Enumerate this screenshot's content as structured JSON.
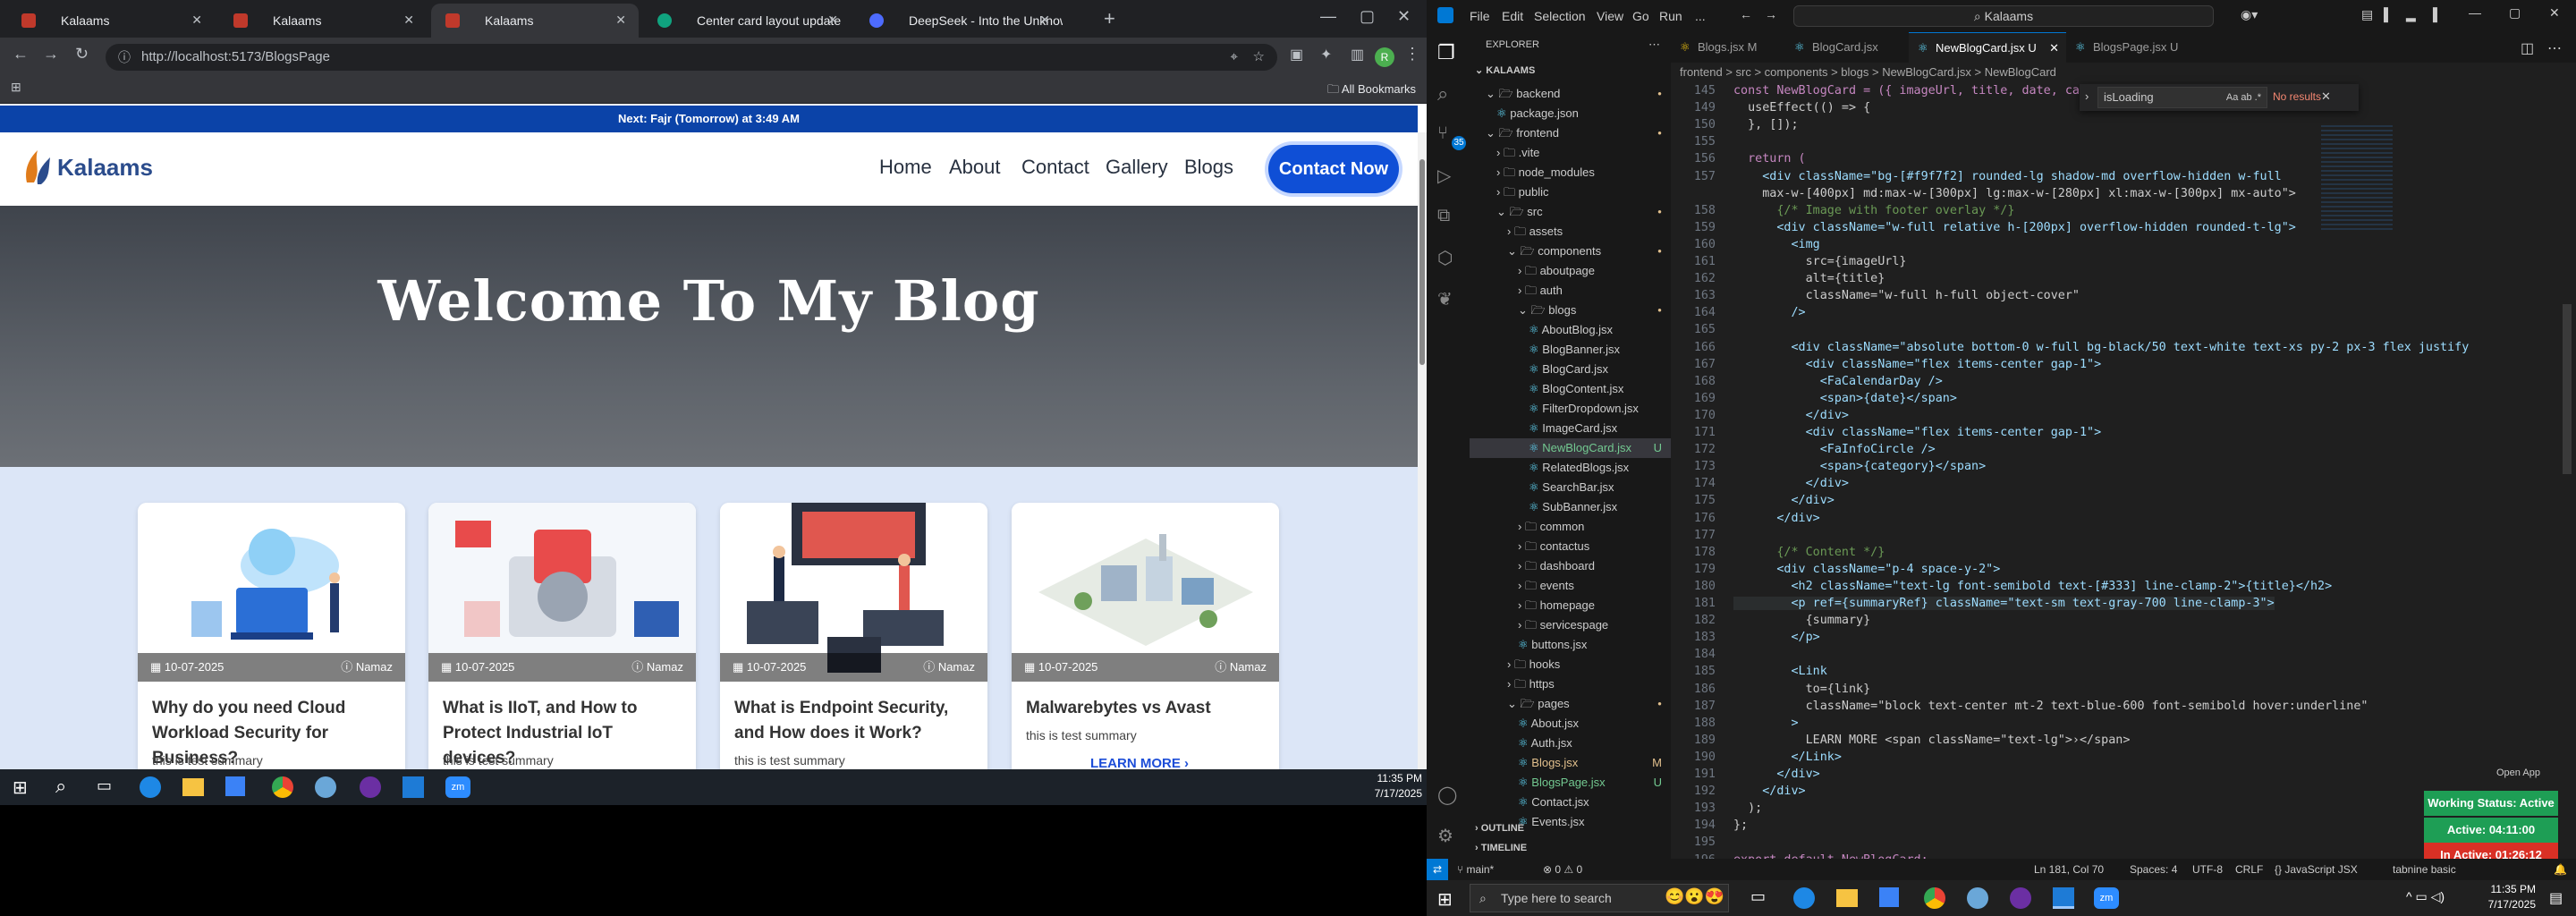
{
  "browser": {
    "tabs": [
      {
        "label": "Kalaams",
        "favcolor": "#c0392b"
      },
      {
        "label": "Kalaams",
        "favcolor": "#c0392b"
      },
      {
        "label": "Kalaams",
        "favcolor": "#c0392b"
      },
      {
        "label": "Center card layout update",
        "favcolor": "#10a37f"
      },
      {
        "label": "DeepSeek - Into the Unknown",
        "favcolor": "#4d6bfe"
      }
    ],
    "url": "http://localhost:5173/BlogsPage",
    "all_bookmarks": "All Bookmarks",
    "profile_initial": "R"
  },
  "site": {
    "announcement": "Next: Fajr (Tomorrow) at 3:49 AM",
    "logo": "Kalaams",
    "nav": [
      "Home",
      "About",
      "Contact",
      "Gallery",
      "Blogs"
    ],
    "cta": "Contact Now",
    "hero_title": "Welcome To My Blog",
    "cards": [
      {
        "date": "10-07-2025",
        "category": "Namaz",
        "title": "Why do you need Cloud Workload Security for Business?",
        "summary": "this is test summary",
        "more": ""
      },
      {
        "date": "10-07-2025",
        "category": "Namaz",
        "title": "What is IIoT, and How to Protect Industrial IoT devices?",
        "summary": "this is test summary",
        "more": ""
      },
      {
        "date": "10-07-2025",
        "category": "Namaz",
        "title": "What is Endpoint Security, and How does it Work?",
        "summary": "this is test summary",
        "more": ""
      },
      {
        "date": "10-07-2025",
        "category": "Namaz",
        "title": "Malwarebytes vs Avast",
        "summary": "this is test summary",
        "more": "LEARN MORE ›"
      }
    ]
  },
  "taskbar_left": {
    "time": "11:35 PM",
    "date": "7/17/2025"
  },
  "vscode": {
    "menu": [
      "File",
      "Edit",
      "Selection",
      "View",
      "Go",
      "Run",
      "..."
    ],
    "search": "Kalaams",
    "explorer_title": "EXPLORER",
    "root": "KALAAMS",
    "tree": [
      {
        "label": "backend",
        "indent": 1,
        "type": "folder-open",
        "status": "dot"
      },
      {
        "label": "package.json",
        "indent": 2,
        "type": "file",
        "status": ""
      },
      {
        "label": "frontend",
        "indent": 1,
        "type": "folder-open",
        "status": "dot"
      },
      {
        "label": ".vite",
        "indent": 2,
        "type": "folder",
        "status": ""
      },
      {
        "label": "node_modules",
        "indent": 2,
        "type": "folder",
        "status": ""
      },
      {
        "label": "public",
        "indent": 2,
        "type": "folder",
        "status": ""
      },
      {
        "label": "src",
        "indent": 2,
        "type": "folder-open",
        "status": "dot"
      },
      {
        "label": "assets",
        "indent": 3,
        "type": "folder",
        "status": ""
      },
      {
        "label": "components",
        "indent": 3,
        "type": "folder-open",
        "status": "dot"
      },
      {
        "label": "aboutpage",
        "indent": 4,
        "type": "folder",
        "status": ""
      },
      {
        "label": "auth",
        "indent": 4,
        "type": "folder",
        "status": ""
      },
      {
        "label": "blogs",
        "indent": 4,
        "type": "folder-open",
        "status": "dot"
      },
      {
        "label": "AboutBlog.jsx",
        "indent": 5,
        "type": "file",
        "status": ""
      },
      {
        "label": "BlogBanner.jsx",
        "indent": 5,
        "type": "file",
        "status": ""
      },
      {
        "label": "BlogCard.jsx",
        "indent": 5,
        "type": "file",
        "status": ""
      },
      {
        "label": "BlogContent.jsx",
        "indent": 5,
        "type": "file",
        "status": ""
      },
      {
        "label": "FilterDropdown.jsx",
        "indent": 5,
        "type": "file",
        "status": ""
      },
      {
        "label": "ImageCard.jsx",
        "indent": 5,
        "type": "file",
        "status": ""
      },
      {
        "label": "NewBlogCard.jsx",
        "indent": 5,
        "type": "file",
        "status": "U",
        "active": true
      },
      {
        "label": "RelatedBlogs.jsx",
        "indent": 5,
        "type": "file",
        "status": ""
      },
      {
        "label": "SearchBar.jsx",
        "indent": 5,
        "type": "file",
        "status": ""
      },
      {
        "label": "SubBanner.jsx",
        "indent": 5,
        "type": "file",
        "status": ""
      },
      {
        "label": "common",
        "indent": 4,
        "type": "folder",
        "status": ""
      },
      {
        "label": "contactus",
        "indent": 4,
        "type": "folder",
        "status": ""
      },
      {
        "label": "dashboard",
        "indent": 4,
        "type": "folder",
        "status": ""
      },
      {
        "label": "events",
        "indent": 4,
        "type": "folder",
        "status": ""
      },
      {
        "label": "homepage",
        "indent": 4,
        "type": "folder",
        "status": ""
      },
      {
        "label": "servicespage",
        "indent": 4,
        "type": "folder",
        "status": ""
      },
      {
        "label": "buttons.jsx",
        "indent": 4,
        "type": "file",
        "status": ""
      },
      {
        "label": "hooks",
        "indent": 3,
        "type": "folder",
        "status": ""
      },
      {
        "label": "https",
        "indent": 3,
        "type": "folder",
        "status": ""
      },
      {
        "label": "pages",
        "indent": 3,
        "type": "folder-open",
        "status": "dot"
      },
      {
        "label": "About.jsx",
        "indent": 4,
        "type": "file",
        "status": ""
      },
      {
        "label": "Auth.jsx",
        "indent": 4,
        "type": "file",
        "status": ""
      },
      {
        "label": "Blogs.jsx",
        "indent": 4,
        "type": "file",
        "status": "M"
      },
      {
        "label": "BlogsPage.jsx",
        "indent": 4,
        "type": "file",
        "status": "U"
      },
      {
        "label": "Contact.jsx",
        "indent": 4,
        "type": "file",
        "status": ""
      },
      {
        "label": "Events.jsx",
        "indent": 4,
        "type": "file",
        "status": ""
      }
    ],
    "outline": "OUTLINE",
    "timeline": "TIMELINE",
    "tabs": [
      {
        "label": "Blogs.jsx M",
        "active": false
      },
      {
        "label": "BlogCard.jsx",
        "active": false
      },
      {
        "label": "NewBlogCard.jsx U",
        "active": true
      },
      {
        "label": "BlogsPage.jsx U",
        "active": false
      }
    ],
    "breadcrumb": "frontend > src > components > blogs > NewBlogCard.jsx > NewBlogCard",
    "find": {
      "query": "isLoading",
      "result": "No results"
    },
    "code": [
      {
        "n": "145",
        "t": "const NewBlogCard = ({ imageUrl, title, date, cate"
      },
      {
        "n": "149",
        "t": "  useEffect(() => {"
      },
      {
        "n": "150",
        "t": "  }, []);"
      },
      {
        "n": "155",
        "t": ""
      },
      {
        "n": "156",
        "t": "  return ("
      },
      {
        "n": "157",
        "t": "    <div className=\"bg-[#f9f7f2] rounded-lg shadow-md overflow-hidden w-full"
      },
      {
        "n": "",
        "t": "    max-w-[400px] md:max-w-[300px] lg:max-w-[280px] xl:max-w-[300px] mx-auto\">"
      },
      {
        "n": "158",
        "t": "      {/* Image with footer overlay */}"
      },
      {
        "n": "159",
        "t": "      <div className=\"w-full relative h-[200px] overflow-hidden rounded-t-lg\">"
      },
      {
        "n": "160",
        "t": "        <img"
      },
      {
        "n": "161",
        "t": "          src={imageUrl}"
      },
      {
        "n": "162",
        "t": "          alt={title}"
      },
      {
        "n": "163",
        "t": "          className=\"w-full h-full object-cover\""
      },
      {
        "n": "164",
        "t": "        />"
      },
      {
        "n": "165",
        "t": ""
      },
      {
        "n": "166",
        "t": "        <div className=\"absolute bottom-0 w-full bg-black/50 text-white text-xs py-2 px-3 flex justify"
      },
      {
        "n": "167",
        "t": "          <div className=\"flex items-center gap-1\">"
      },
      {
        "n": "168",
        "t": "            <FaCalendarDay />"
      },
      {
        "n": "169",
        "t": "            <span>{date}</span>"
      },
      {
        "n": "170",
        "t": "          </div>"
      },
      {
        "n": "171",
        "t": "          <div className=\"flex items-center gap-1\">"
      },
      {
        "n": "172",
        "t": "            <FaInfoCircle />"
      },
      {
        "n": "173",
        "t": "            <span>{category}</span>"
      },
      {
        "n": "174",
        "t": "          </div>"
      },
      {
        "n": "175",
        "t": "        </div>"
      },
      {
        "n": "176",
        "t": "      </div>"
      },
      {
        "n": "177",
        "t": ""
      },
      {
        "n": "178",
        "t": "      {/* Content */}"
      },
      {
        "n": "179",
        "t": "      <div className=\"p-4 space-y-2\">"
      },
      {
        "n": "180",
        "t": "        <h2 className=\"text-lg font-semibold text-[#333] line-clamp-2\">{title}</h2>"
      },
      {
        "n": "181",
        "t": "        <p ref={summaryRef} className=\"text-sm text-gray-700 line-clamp-3\">"
      },
      {
        "n": "182",
        "t": "          {summary}"
      },
      {
        "n": "183",
        "t": "        </p>"
      },
      {
        "n": "184",
        "t": ""
      },
      {
        "n": "185",
        "t": "        <Link"
      },
      {
        "n": "186",
        "t": "          to={link}"
      },
      {
        "n": "187",
        "t": "          className=\"block text-center mt-2 text-blue-600 font-semibold hover:underline\""
      },
      {
        "n": "188",
        "t": "        >"
      },
      {
        "n": "189",
        "t": "          LEARN MORE <span className=\"text-lg\">›</span>"
      },
      {
        "n": "190",
        "t": "        </Link>"
      },
      {
        "n": "191",
        "t": "      </div>"
      },
      {
        "n": "192",
        "t": "    </div>"
      },
      {
        "n": "193",
        "t": "  );"
      },
      {
        "n": "194",
        "t": "};"
      },
      {
        "n": "195",
        "t": ""
      },
      {
        "n": "196",
        "t": "export default NewBlogCard;"
      }
    ],
    "status": {
      "branch": "main*",
      "errors": "⊗ 0 ⚠ 0",
      "position": "Ln 181, Col 70",
      "spaces": "Spaces: 4",
      "encoding": "UTF-8",
      "eol": "CRLF",
      "language": "{} JavaScript JSX",
      "tabnine": "tabnine basic"
    },
    "open_app": "Open App",
    "work": {
      "status": "Working Status: Active",
      "active": "Active: 04:11:00",
      "inactive": "In Active: 01:26:12"
    }
  },
  "taskbar_right": {
    "search_placeholder": "Type here to search",
    "time": "11:35 PM",
    "date": "7/17/2025"
  }
}
